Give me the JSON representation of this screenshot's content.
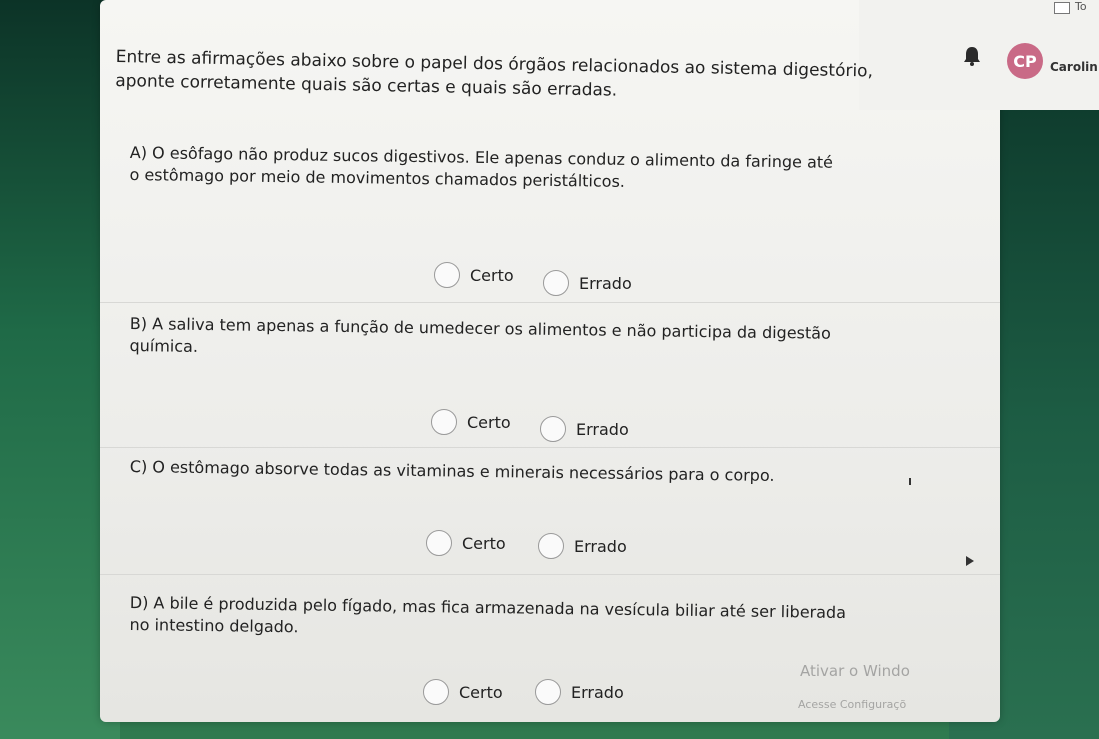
{
  "header": {
    "corner_label": "To",
    "avatar_initials": "CP",
    "username": "Carolin"
  },
  "question": {
    "intro_line1": "Entre as afirmações abaixo sobre o papel dos órgãos relacionados ao sistema digestório,",
    "intro_line2": "aponte corretamente quais são certas e quais são erradas."
  },
  "items": [
    {
      "line1": "A) O esôfago não produz sucos digestivos. Ele apenas conduz o alimento da faringe até",
      "line2": "o estômago por meio de movimentos chamados peristálticos.",
      "opt_true": "Certo",
      "opt_false": "Errado"
    },
    {
      "line1": "B) A saliva tem apenas a função de umedecer os alimentos e não participa da digestão",
      "line2": "química.",
      "opt_true": "Certo",
      "opt_false": "Errado"
    },
    {
      "line1": "C) O estômago absorve todas as vitaminas e minerais necessários para o corpo.",
      "line2": "",
      "opt_true": "Certo",
      "opt_false": "Errado"
    },
    {
      "line1": "D) A bile é produzida pelo fígado, mas fica armazenada na vesícula biliar até ser liberada",
      "line2": "no intestino delgado.",
      "opt_true": "Certo",
      "opt_false": "Errado"
    }
  ],
  "watermark": {
    "line1": "Ativar o Windo",
    "line2": "Acesse Configuraçõ"
  }
}
